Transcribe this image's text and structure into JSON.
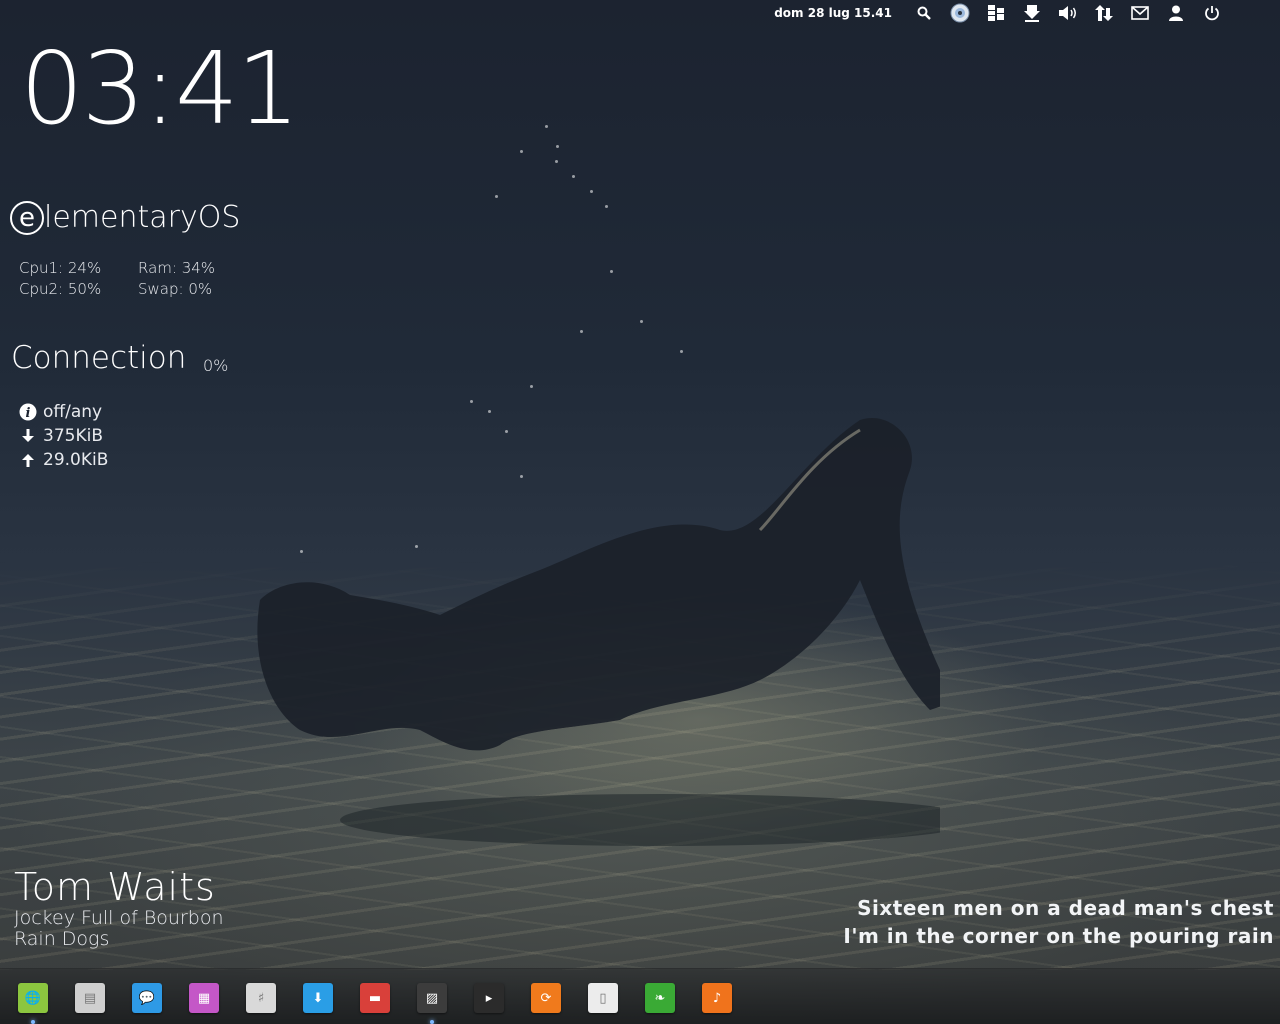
{
  "panel": {
    "datetime": "dom 28 lug 15.41",
    "indicators": [
      "search-icon",
      "disc-icon",
      "network-tree-icon",
      "download-icon",
      "volume-icon",
      "transfer-icon",
      "mail-icon",
      "user-icon",
      "power-icon"
    ]
  },
  "clock": {
    "time": "03:41"
  },
  "brand": {
    "name": "lementaryOS"
  },
  "stats": {
    "cpu1": "Cpu1: 24%",
    "cpu2": "Cpu2: 50%",
    "ram": "Ram: 34%",
    "swap": "Swap: 0%"
  },
  "connection": {
    "title": "Connection",
    "percent": "0%",
    "status": "off/any",
    "down": "375KiB",
    "up": "29.0KiB"
  },
  "music": {
    "artist": "Tom Waits",
    "track": "Jockey Full of Bourbon",
    "album": "Rain Dogs"
  },
  "lyrics": {
    "line1": "Sixteen men on a dead man's chest",
    "line2": "I'm in the corner on the pouring rain"
  },
  "dock": {
    "items": [
      {
        "name": "web-browser-icon",
        "color": "#8cc63f"
      },
      {
        "name": "files-icon",
        "color": "#cfcfcf"
      },
      {
        "name": "chat-icon",
        "color": "#2e9ae6"
      },
      {
        "name": "video-player-icon",
        "color": "#c457c7"
      },
      {
        "name": "system-settings-icon",
        "color": "#d9d9d9"
      },
      {
        "name": "software-center-icon",
        "color": "#2a9ee6"
      },
      {
        "name": "calendar-icon",
        "color": "#d9403a"
      },
      {
        "name": "system-monitor-icon",
        "color": "#3c3c3c"
      },
      {
        "name": "terminal-icon",
        "color": "#2b2b2b"
      },
      {
        "name": "update-manager-icon",
        "color": "#f07a1c"
      },
      {
        "name": "text-editor-icon",
        "color": "#ececec"
      },
      {
        "name": "leaf-app-icon",
        "color": "#3aaa35"
      },
      {
        "name": "music-player-icon",
        "color": "#f0731c"
      }
    ]
  }
}
